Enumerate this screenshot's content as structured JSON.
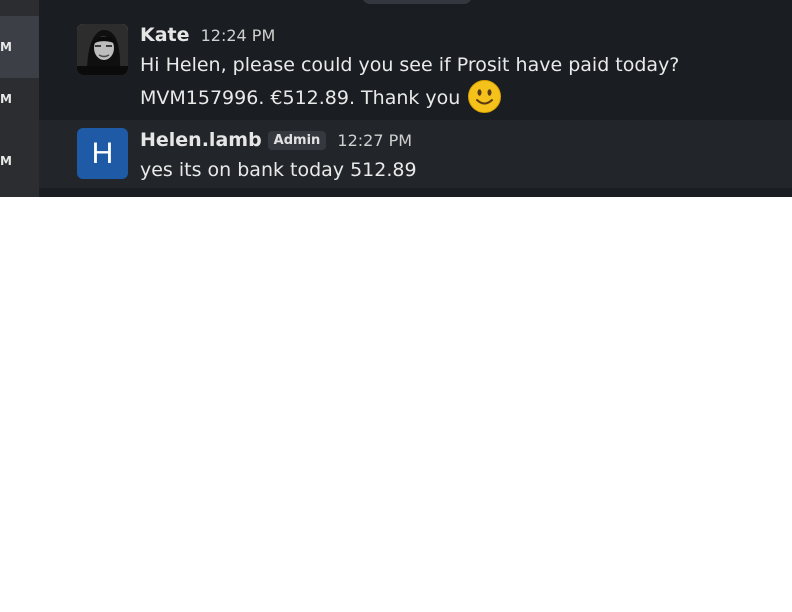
{
  "rail": {
    "items": [
      {
        "label": "M"
      },
      {
        "label": "M"
      },
      {
        "label": "M"
      }
    ]
  },
  "messages": [
    {
      "author": "Kate",
      "time": "12:24 PM",
      "text": "Hi Helen, please could you see if Prosit have paid today? MVM157996. €512.89. Thank you",
      "emoji": "slightly-smiling-face-icon"
    },
    {
      "author": "Helen.lamb",
      "avatar_letter": "H",
      "badge": "Admin",
      "time": "12:27 PM",
      "text": "yes its on bank today 512.89"
    }
  ],
  "colors": {
    "background": "#1a1d21",
    "rail": "#2b2d31",
    "avatar_blue": "#1f5aa6",
    "emoji_yellow": "#f4c21b"
  }
}
